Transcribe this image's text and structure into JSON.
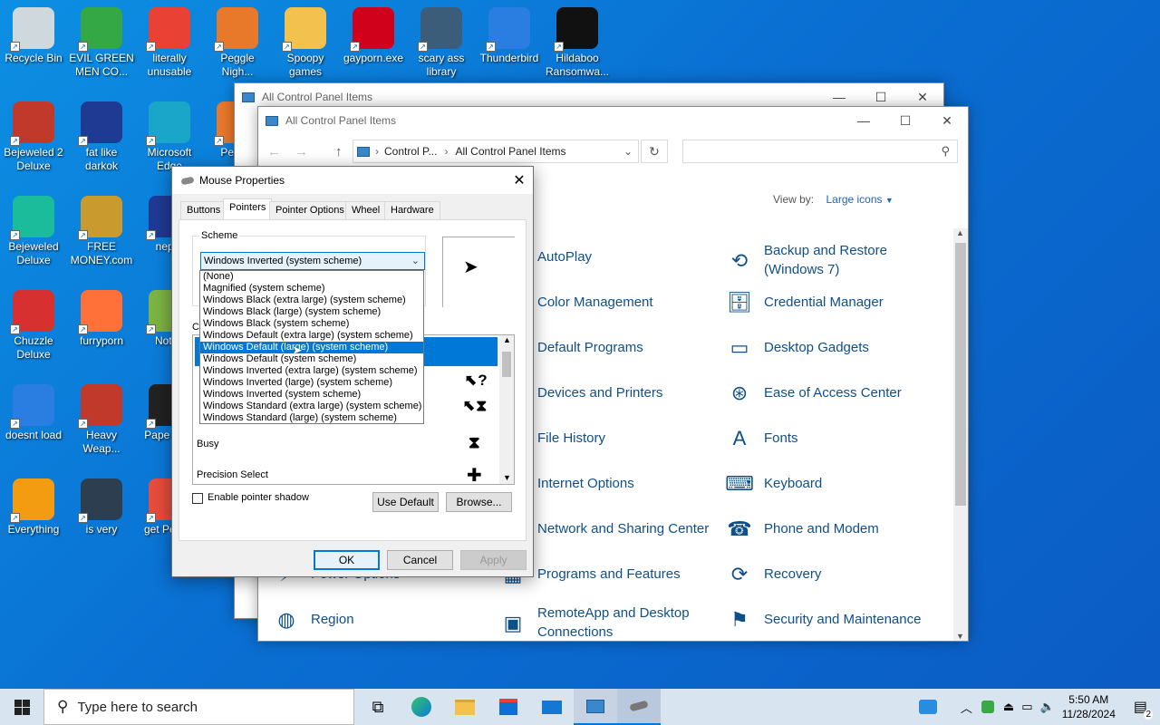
{
  "desktop_icons": [
    {
      "label": "Recycle Bin",
      "col": 0,
      "row": 0,
      "color": "#cfd8dc"
    },
    {
      "label": "EVIL GREEN MEN CO...",
      "col": 1,
      "row": 0,
      "color": "#33a845"
    },
    {
      "label": "literally unusable",
      "col": 2,
      "row": 0,
      "color": "#e94235"
    },
    {
      "label": "Peggle Nigh...",
      "col": 3,
      "row": 0,
      "color": "#e8782a"
    },
    {
      "label": "Spoopy games",
      "col": 4,
      "row": 0,
      "color": "#f2c14e"
    },
    {
      "label": "gayporn.exe",
      "col": 5,
      "row": 0,
      "color": "#d0021b"
    },
    {
      "label": "scary ass library",
      "col": 6,
      "row": 0,
      "color": "#3b5d7a"
    },
    {
      "label": "Thunderbird",
      "col": 7,
      "row": 0,
      "color": "#2a7de1"
    },
    {
      "label": "Hildaboo Ransomwa...",
      "col": 8,
      "row": 0,
      "color": "#111111"
    },
    {
      "label": "Bejeweled 2 Deluxe",
      "col": 0,
      "row": 1,
      "color": "#c0392b"
    },
    {
      "label": "fat like darkok",
      "col": 1,
      "row": 1,
      "color": "#1f3a93"
    },
    {
      "label": "Microsoft Edge",
      "col": 2,
      "row": 1,
      "color": "#1aa6c8"
    },
    {
      "label": "Peggle",
      "col": 3,
      "row": 1,
      "color": "#e8782a"
    },
    {
      "label": "Bejeweled Deluxe",
      "col": 0,
      "row": 2,
      "color": "#1abc9c"
    },
    {
      "label": "FREE MONEY.com",
      "col": 1,
      "row": 2,
      "color": "#c99a2e"
    },
    {
      "label": "nephr",
      "col": 2,
      "row": 2,
      "color": "#1f3a93"
    },
    {
      "label": "Chuzzle Deluxe",
      "col": 0,
      "row": 3,
      "color": "#d63031"
    },
    {
      "label": "furryporn",
      "col": 1,
      "row": 3,
      "color": "#ff7139"
    },
    {
      "label": "Notep",
      "col": 2,
      "row": 3,
      "color": "#7cb342"
    },
    {
      "label": "doesnt load",
      "col": 0,
      "row": 4,
      "color": "#2a7de1"
    },
    {
      "label": "Heavy Weap...",
      "col": 1,
      "row": 4,
      "color": "#c0392b"
    },
    {
      "label": "Pape Plea",
      "col": 2,
      "row": 4,
      "color": "#222222"
    },
    {
      "label": "Everything",
      "col": 0,
      "row": 5,
      "color": "#f39c12"
    },
    {
      "label": "is very",
      "col": 1,
      "row": 5,
      "color": "#2c3e50"
    },
    {
      "label": "get Pe Del",
      "col": 2,
      "row": 5,
      "color": "#e74c3c"
    }
  ],
  "back_window": {
    "title": "All Control Panel Items"
  },
  "front_window": {
    "title": "All Control Panel Items",
    "breadcrumb": [
      "Control P...",
      "All Control Panel Items"
    ],
    "view_by_label": "View by:",
    "view_by_value": "Large icons",
    "items": [
      {
        "label": "AutoPlay",
        "col": 1,
        "row": 0,
        "icon": "▶"
      },
      {
        "label": "Backup and Restore (Windows 7)",
        "col": 2,
        "row": 0,
        "icon": "⟲"
      },
      {
        "label": "Color Management",
        "col": 1,
        "row": 1,
        "icon": "◐"
      },
      {
        "label": "Credential Manager",
        "col": 2,
        "row": 1,
        "icon": "🗄"
      },
      {
        "label": "Default Programs",
        "col": 1,
        "row": 2,
        "icon": "✔"
      },
      {
        "label": "Desktop Gadgets",
        "col": 2,
        "row": 2,
        "icon": "▭"
      },
      {
        "label": "Devices and Printers",
        "col": 1,
        "row": 3,
        "icon": "⎙"
      },
      {
        "label": "Ease of Access Center",
        "col": 2,
        "row": 3,
        "icon": "⊛"
      },
      {
        "label": "File History",
        "col": 1,
        "row": 4,
        "icon": "🗀"
      },
      {
        "label": "Fonts",
        "col": 2,
        "row": 4,
        "icon": "A"
      },
      {
        "label": "Internet Options",
        "col": 1,
        "row": 5,
        "icon": "◎"
      },
      {
        "label": "Keyboard",
        "col": 2,
        "row": 5,
        "icon": "⌨"
      },
      {
        "label": "Network and Sharing Center",
        "col": 1,
        "row": 6,
        "icon": "⧉"
      },
      {
        "label": "Phone and Modem",
        "col": 2,
        "row": 6,
        "icon": "☎"
      },
      {
        "label": "Power Options",
        "col": 0,
        "row": 7,
        "icon": "⚡"
      },
      {
        "label": "Programs and Features",
        "col": 1,
        "row": 7,
        "icon": "▦"
      },
      {
        "label": "Recovery",
        "col": 2,
        "row": 7,
        "icon": "⟳"
      },
      {
        "label": "Region",
        "col": 0,
        "row": 8,
        "icon": "◍"
      },
      {
        "label": "RemoteApp and Desktop Connections",
        "col": 1,
        "row": 8,
        "icon": "▣"
      },
      {
        "label": "Security and Maintenance",
        "col": 2,
        "row": 8,
        "icon": "⚑"
      }
    ]
  },
  "dialog": {
    "title": "Mouse Properties",
    "tabs": [
      "Buttons",
      "Pointers",
      "Pointer Options",
      "Wheel",
      "Hardware"
    ],
    "active_tab": "Pointers",
    "scheme_label": "Scheme",
    "scheme_value": "Windows Inverted (system scheme)",
    "customize_label_partial": "Cu",
    "scheme_options": [
      "(None)",
      "Magnified (system scheme)",
      "Windows Black (extra large) (system scheme)",
      "Windows Black (large) (system scheme)",
      "Windows Black (system scheme)",
      "Windows Default (extra large) (system scheme)",
      "Windows Default (large) (system scheme)",
      "Windows Default (system scheme)",
      "Windows Inverted (extra large) (system scheme)",
      "Windows Inverted (large) (system scheme)",
      "Windows Inverted (system scheme)",
      "Windows Standard (extra large) (system scheme)",
      "Windows Standard (large) (system scheme)"
    ],
    "highlighted_option_index": 6,
    "pointer_rows": [
      {
        "label": "Busy",
        "glyph": "⧗"
      },
      {
        "label": "Precision Select",
        "glyph": "✚"
      }
    ],
    "enable_shadow_label": "Enable pointer shadow",
    "use_default": "Use Default",
    "browse": "Browse...",
    "ok": "OK",
    "cancel": "Cancel",
    "apply": "Apply"
  },
  "taskbar": {
    "search_placeholder": "Type here to search",
    "time": "5:50 AM",
    "date": "11/28/2024",
    "notification_count": "2"
  }
}
